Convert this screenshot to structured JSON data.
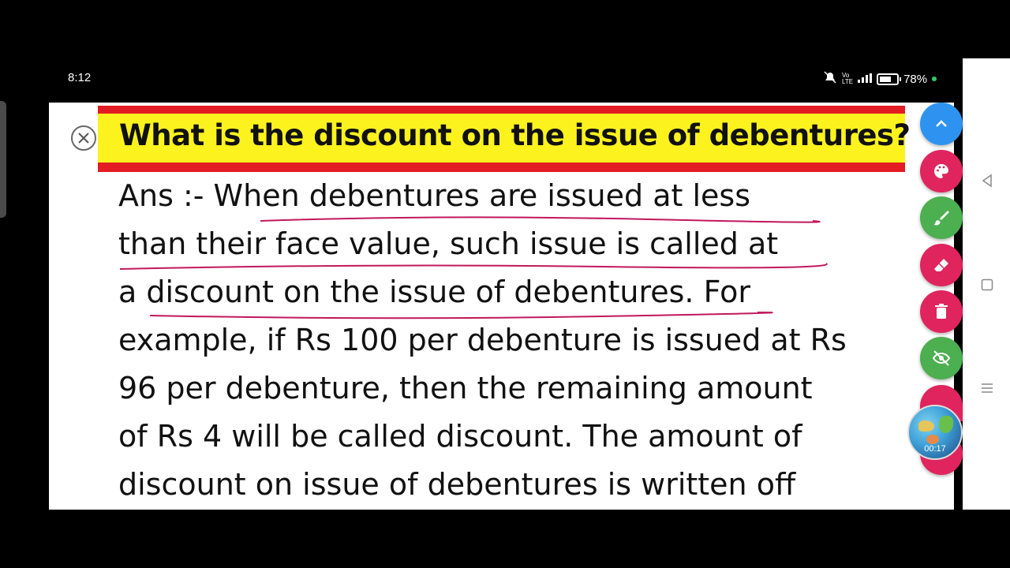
{
  "status_bar": {
    "time": "8:12",
    "battery_percent": "78%",
    "battery_level": 0.78
  },
  "document": {
    "title": "What is the discount on the issue of debentures?",
    "answer_lines": [
      "Ans :- When debentures are issued at less",
      "than their face value, such issue is called at",
      "a discount on the issue of debentures. For",
      "example, if Rs 100 per debenture is issued at Rs",
      "96 per debenture, then the remaining amount",
      "of Rs 4 will be called discount. The amount of",
      "discount on issue of debentures is written off"
    ]
  },
  "toolbar": {
    "buttons": [
      {
        "icon": "chevron-up-icon",
        "color": "#2e93f0"
      },
      {
        "icon": "palette-icon",
        "color": "#e0245e"
      },
      {
        "icon": "brush-icon",
        "color": "#4caf50"
      },
      {
        "icon": "eraser-icon",
        "color": "#e0245e"
      },
      {
        "icon": "trash-icon",
        "color": "#e0245e"
      },
      {
        "icon": "eye-off-icon",
        "color": "#4caf50"
      }
    ]
  },
  "video": {
    "elapsed": "00:17"
  },
  "colors": {
    "title_band_red": "#e31b23",
    "title_band_yellow": "#fbf21e",
    "underline": "#c2185b"
  }
}
